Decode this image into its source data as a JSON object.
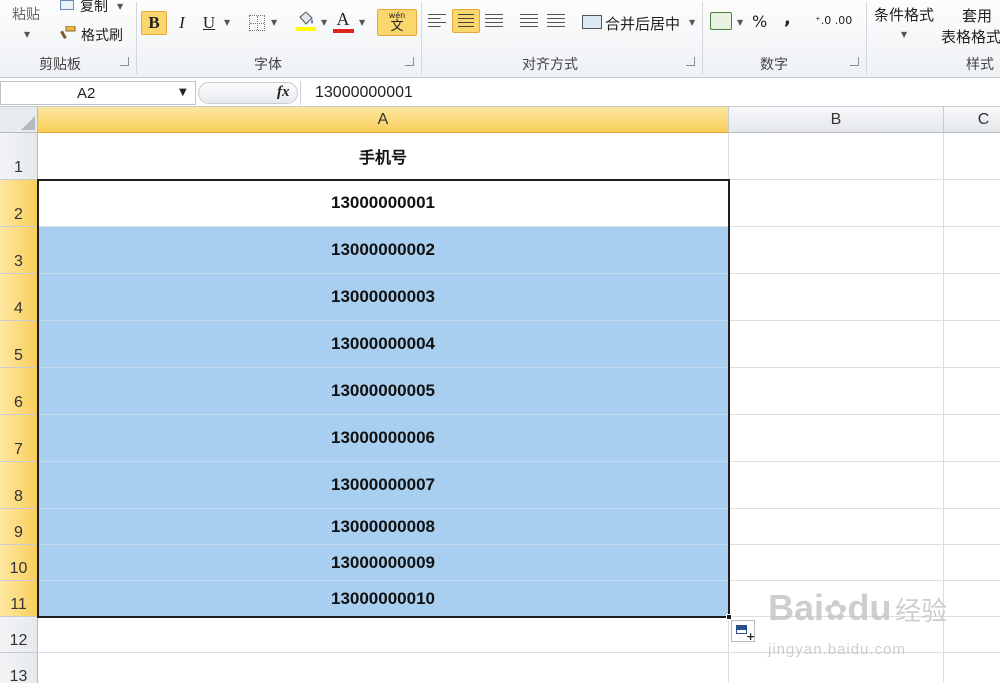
{
  "ribbon": {
    "clipboard": {
      "paste": "粘贴",
      "copy": "复制",
      "format_painter": "格式刷",
      "label": "剪贴板"
    },
    "font": {
      "bold": "B",
      "italic": "I",
      "underline": "U",
      "font_color_glyph": "A",
      "phonetic_glyph": "wén",
      "phonetic_char": "文",
      "label": "字体"
    },
    "alignment": {
      "merge_center": "合并后居中",
      "label": "对齐方式"
    },
    "number": {
      "percent": "%",
      "comma": ",",
      "label": "数字"
    },
    "styles": {
      "conditional_format": "条件格式",
      "table_format_top": "套用",
      "table_format_bottom": "表格格式",
      "label": "样式"
    }
  },
  "formula_bar": {
    "name_box": "A2",
    "fx": "fx",
    "formula": "13000000001"
  },
  "columns": [
    "A",
    "B",
    "C"
  ],
  "rows": [
    "1",
    "2",
    "3",
    "4",
    "5",
    "6",
    "7",
    "8",
    "9",
    "10",
    "11",
    "12",
    "13"
  ],
  "cells": {
    "A1": "手机号",
    "A2": "13000000001",
    "A3": "13000000002",
    "A4": "13000000003",
    "A5": "13000000004",
    "A6": "13000000005",
    "A7": "13000000006",
    "A8": "13000000007",
    "A9": "13000000008",
    "A10": "13000000009",
    "A11": "13000000010"
  },
  "watermark": {
    "brand": "Bai",
    "brand2": "du",
    "cn": "经验",
    "url": "jingyan.baidu.com"
  },
  "colors": {
    "selection_fill": "#a8cfef",
    "active_header": "#f8cf5a",
    "font_color_bar": "#e0231b",
    "highlight_bar": "#ffff00"
  }
}
